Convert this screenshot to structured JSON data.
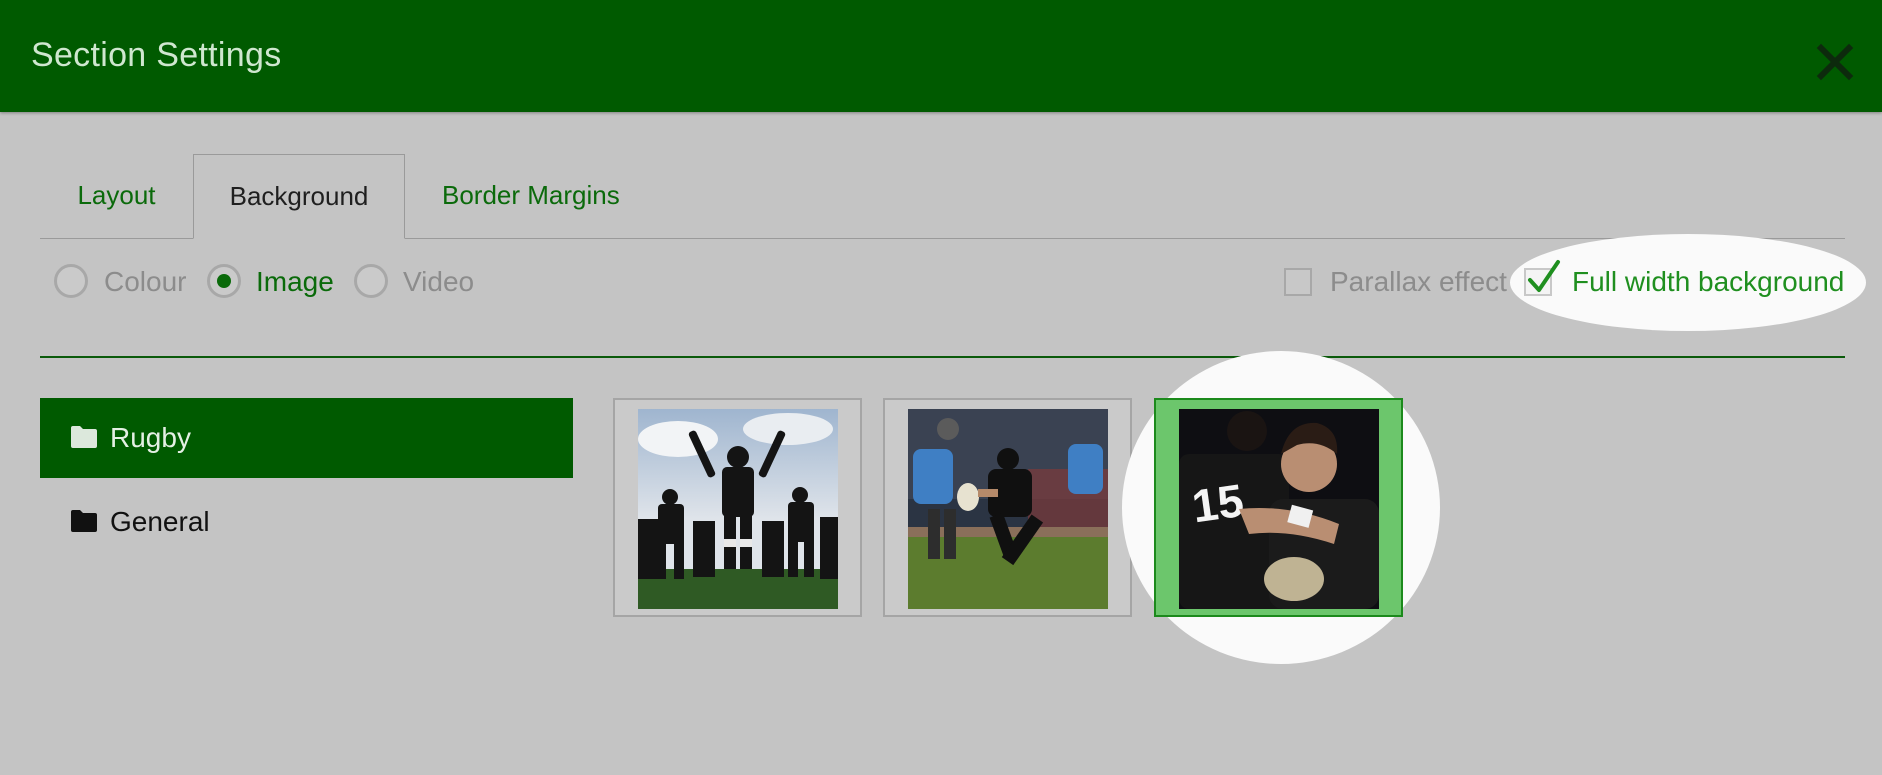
{
  "dialog": {
    "title": "Section Settings",
    "close_icon": "close-icon"
  },
  "tabs": [
    {
      "label": "Layout",
      "active": false
    },
    {
      "label": "Background",
      "active": true
    },
    {
      "label": "Border Margins",
      "active": false
    }
  ],
  "background_type": {
    "options": [
      {
        "label": "Colour",
        "checked": false
      },
      {
        "label": "Image",
        "checked": true
      },
      {
        "label": "Video",
        "checked": false
      }
    ]
  },
  "checkboxes": {
    "parallax": {
      "label": "Parallax effect",
      "checked": false
    },
    "full_width": {
      "label": "Full width background",
      "checked": true
    }
  },
  "folders": [
    {
      "label": "Rugby",
      "icon": "folder-icon",
      "active": true
    },
    {
      "label": "General",
      "icon": "folder-icon",
      "active": false
    }
  ],
  "images": [
    {
      "subject": "haka-team",
      "selected": false
    },
    {
      "subject": "player-running",
      "selected": false
    },
    {
      "subject": "player-number-15",
      "selected": true
    }
  ],
  "colors": {
    "header": "#005a00",
    "accent": "#0a6a0a",
    "background": "#c4c4c4"
  }
}
